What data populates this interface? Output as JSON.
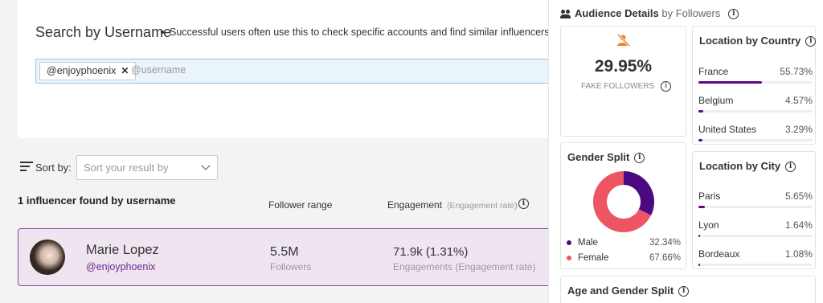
{
  "search": {
    "title": "Search by Username",
    "subtitle": "Successful users often use this to check specific accounts and find similar influencers",
    "chip_label": "@enjoyphoenix",
    "placeholder": "@username"
  },
  "sort": {
    "label": "Sort by:",
    "placeholder": "Sort your result by"
  },
  "results": {
    "count_text": "1 influencer found by username",
    "col_follower": "Follower range",
    "col_engagement": "Engagement",
    "col_engagement_sub": "(Engagement rate)",
    "rows": [
      {
        "name": "Marie Lopez",
        "handle": "@enjoyphoenix",
        "followers": "5.5M",
        "followers_label": "Followers",
        "engagement": "71.9k (1.31%)",
        "engagement_label": "Engagements (Engagement rate)"
      }
    ]
  },
  "panel": {
    "title": "Audience Details",
    "by": "by Followers",
    "fake": {
      "value": "29.95%",
      "label": "FAKE FOLLOWERS"
    },
    "country": {
      "title": "Location by Country",
      "items": [
        {
          "name": "France",
          "pct": "55.73%",
          "fraction": 0.5573
        },
        {
          "name": "Belgium",
          "pct": "4.57%",
          "fraction": 0.0457
        },
        {
          "name": "United States",
          "pct": "3.29%",
          "fraction": 0.0329
        }
      ]
    },
    "gender": {
      "title": "Gender Split",
      "items": [
        {
          "name": "Male",
          "pct": "32.34%",
          "fraction": 0.3234,
          "color": "#4b0a82"
        },
        {
          "name": "Female",
          "pct": "67.66%",
          "fraction": 0.6766,
          "color": "#ee5563"
        }
      ]
    },
    "city": {
      "title": "Location by City",
      "items": [
        {
          "name": "Paris",
          "pct": "5.65%",
          "fraction": 0.0565
        },
        {
          "name": "Lyon",
          "pct": "1.64%",
          "fraction": 0.0164
        },
        {
          "name": "Bordeaux",
          "pct": "1.08%",
          "fraction": 0.0108
        }
      ]
    },
    "age": {
      "title": "Age and Gender Split"
    }
  },
  "colors": {
    "accent": "#5b0a8a",
    "row_bg": "#efe5f1",
    "handle": "#6a2b8e"
  },
  "icons": {
    "fake": "user-off-icon",
    "people": "people-icon",
    "info": "info-icon",
    "sort": "sort-lines-icon"
  }
}
